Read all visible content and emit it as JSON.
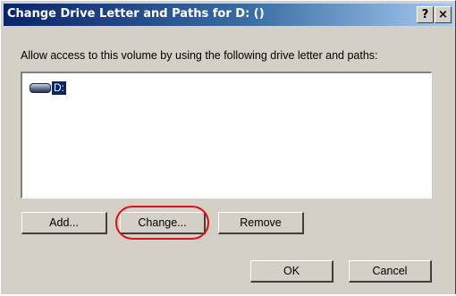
{
  "dialog": {
    "title": "Change Drive Letter and Paths for D: ()",
    "help_label": "?",
    "close_label": "×",
    "prompt": "Allow access to this volume by using the following drive letter and paths:"
  },
  "list": {
    "items": [
      {
        "label": "D:",
        "icon": "drive-icon",
        "selected": true
      }
    ]
  },
  "buttons": {
    "add": "Add...",
    "change": "Change...",
    "remove": "Remove",
    "ok": "OK",
    "cancel": "Cancel"
  },
  "annotation": {
    "highlight_color": "#e01010",
    "highlighted": "change-button"
  },
  "colors": {
    "face": "#d4d0c8",
    "titlebar": "#0a246a",
    "selection": "#0a246a"
  }
}
